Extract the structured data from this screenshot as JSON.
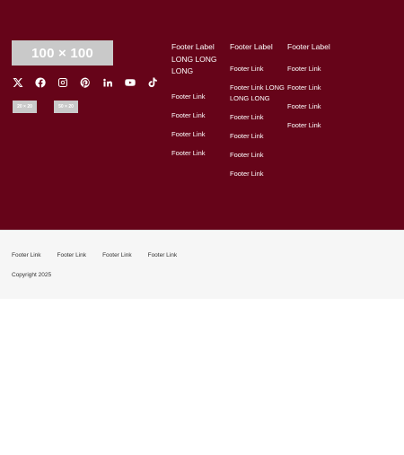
{
  "brand": {
    "logo_text": "100 × 100"
  },
  "social": [
    {
      "icon": "x-icon"
    },
    {
      "icon": "facebook-icon"
    },
    {
      "icon": "instagram-icon"
    },
    {
      "icon": "pinterest-icon"
    },
    {
      "icon": "linkedin-icon"
    },
    {
      "icon": "youtube-icon"
    },
    {
      "icon": "tiktok-icon"
    }
  ],
  "badges": [
    {
      "label": "20 × 20"
    },
    {
      "label": "50 × 20"
    }
  ],
  "columns": [
    {
      "title": "Footer Label LONG LONG LONG",
      "links": [
        "Footer Link",
        "Footer Link",
        "Footer Link",
        "Footer Link"
      ]
    },
    {
      "title": "Footer Label",
      "links": [
        "Footer Link",
        "Footer Link LONG LONG LONG",
        "Footer Link",
        "Footer Link",
        "Footer Link",
        "Footer Link"
      ]
    },
    {
      "title": "Footer Label",
      "links": [
        "Footer Link",
        "Footer Link",
        "Footer Link",
        "Footer Link"
      ]
    }
  ],
  "bottom": {
    "links": [
      "Footer Link",
      "Footer Link",
      "Footer Link",
      "Footer Link"
    ],
    "copyright": "Copyright 2025"
  },
  "colors": {
    "footer_bg": "#660419",
    "bottom_bg": "#f6f6f6",
    "placeholder": "#c9c9c9"
  }
}
